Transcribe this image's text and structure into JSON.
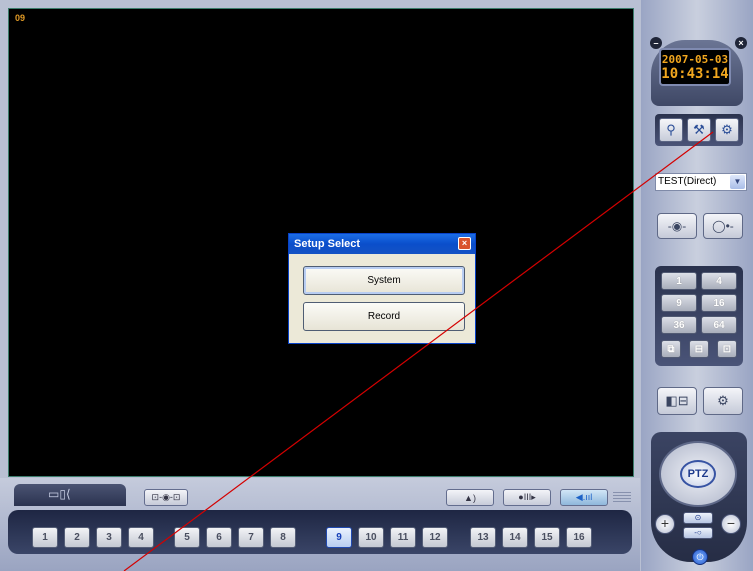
{
  "video": {
    "channel_label": "09"
  },
  "dialog": {
    "title": "Setup Select",
    "close_glyph": "×",
    "buttons": [
      {
        "label": "System"
      },
      {
        "label": "Record"
      }
    ]
  },
  "bottom_bar": {
    "tab_icon": "camera-layout-icon",
    "buttons": {
      "connect": {
        "icon": "network-link-icon",
        "glyph": "⊡-◉-⊡"
      },
      "alarm": {
        "icon": "bell-icon",
        "glyph": "▲)"
      },
      "audio_mic": {
        "icon": "microphone-icon",
        "glyph": "●III▸"
      },
      "volume": {
        "icon": "speaker-volume-icon",
        "glyph": "◀.ııl"
      }
    },
    "channels": [
      "1",
      "2",
      "3",
      "4",
      "5",
      "6",
      "7",
      "8",
      "9",
      "10",
      "11",
      "12",
      "13",
      "14",
      "15",
      "16"
    ],
    "selected_channel": "9"
  },
  "right_panel": {
    "date": "2007-05-03",
    "time": "10:43:14",
    "minimize_glyph": "–",
    "close_glyph": "×",
    "tool_icons": [
      "search-icon",
      "wrench-icon",
      "gear-icon"
    ],
    "tool_glyphs": [
      "⚲",
      "⚒",
      "⚙"
    ],
    "site_select": {
      "value": "TEST(Direct)",
      "arrow": "▼"
    },
    "connect_buttons": [
      "-◉-",
      "◯•-"
    ],
    "split_buttons": [
      "1",
      "4",
      "9",
      "16",
      "36",
      "64"
    ],
    "split_icon_glyphs": [
      "⧉",
      "⊟",
      "⊡"
    ],
    "action_glyphs": [
      "◧⊟",
      "⚙"
    ],
    "ptz": {
      "label": "PTZ",
      "zoom_in": "+",
      "zoom_out": "−",
      "focus_glyph": "⊙",
      "iris_glyph": "-○",
      "power_glyph": "⏻"
    }
  },
  "colors": {
    "accent": "#1d62c7",
    "clock_text": "#f2a71f",
    "annotation_line": "#d40000"
  }
}
